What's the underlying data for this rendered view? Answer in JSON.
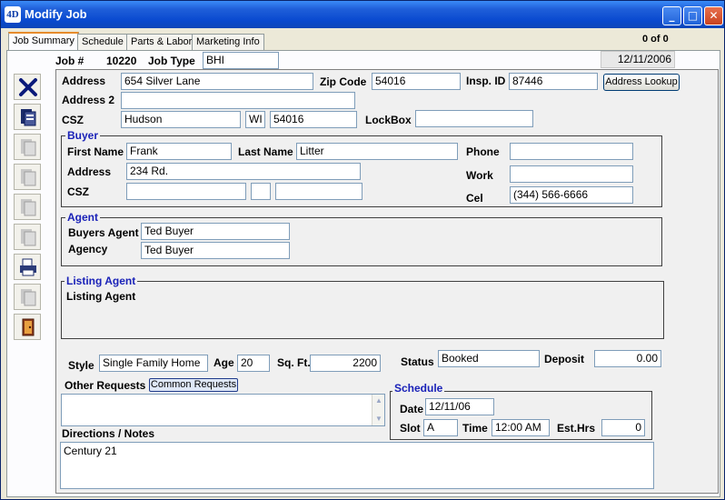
{
  "window": {
    "title": "Modify Job",
    "app_icon": "4D"
  },
  "tabs": [
    "Job Summary",
    "Schedule",
    "Parts & Labor",
    "Marketing Info"
  ],
  "record_counter": "0 of 0",
  "job": {
    "job_num_label": "Job #",
    "job_num": "10220",
    "job_type_label": "Job Type",
    "job_type": "BHI",
    "date": "12/11/2006"
  },
  "property": {
    "address_label": "Address",
    "address": "654 Silver Lane",
    "zip_label": "Zip Code",
    "zip": "54016",
    "insp_label": "Insp. ID",
    "insp_id": "87446",
    "address_lookup": "Address Lookup",
    "address2_label": "Address 2",
    "address2": "",
    "csz_label": "CSZ",
    "city": "Hudson",
    "state": "WI",
    "csz_zip": "54016",
    "lockbox_label": "LockBox",
    "lockbox": ""
  },
  "buyer": {
    "title": "Buyer",
    "first_label": "First Name",
    "first": "Frank",
    "last_label": "Last Name",
    "last": "Litter",
    "phone_label": "Phone",
    "phone": "",
    "address_label": "Address",
    "address": "234 Rd.",
    "work_label": "Work",
    "work": "",
    "csz_label": "CSZ",
    "city": "",
    "state": "",
    "zip": "",
    "cel_label": "Cel",
    "cel": "(344) 566-6666"
  },
  "agent": {
    "title": "Agent",
    "buyers_label": "Buyers Agent",
    "buyers": "Ted Buyer",
    "agency_label": "Agency",
    "agency": "Ted Buyer"
  },
  "listing": {
    "title": "Listing Agent",
    "label": "Listing Agent"
  },
  "details": {
    "style_label": "Style",
    "style": "Single Family Home",
    "age_label": "Age",
    "age": "20",
    "sqft_label": "Sq. Ft.",
    "sqft": "2200",
    "status_label": "Status",
    "status": "Booked",
    "deposit_label": "Deposit",
    "deposit": "0.00"
  },
  "requests": {
    "label": "Other Requests",
    "button": "Common Requests",
    "value": ""
  },
  "schedule": {
    "title": "Schedule",
    "date_label": "Date",
    "date": "12/11/06",
    "slot_label": "Slot",
    "slot": "A",
    "time_label": "Time",
    "time": "12:00 AM",
    "esthrs_label": "Est.Hrs",
    "esthrs": "0"
  },
  "notes": {
    "label": "Directions / Notes",
    "value": "Century 21"
  },
  "toolbar": [
    "cancel-x-icon",
    "save-record-icon",
    "record-icon",
    "record-icon",
    "record-icon",
    "record-icon",
    "print-icon",
    "record-icon",
    "exit-door-icon"
  ],
  "colors": {
    "titlebar": "#0a4ad0",
    "group_title": "#1a22b8",
    "panel": "#f0f0f0"
  }
}
